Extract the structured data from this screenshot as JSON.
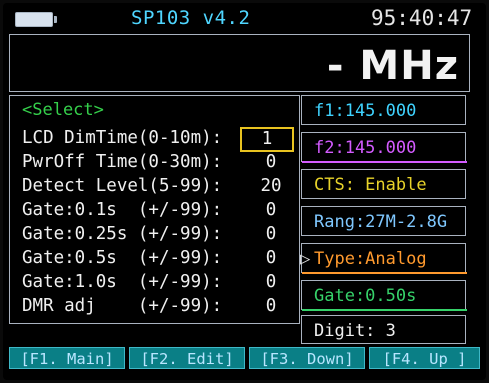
{
  "status_bar": {
    "model": "SP103 v4.2",
    "clock": "95:40:47"
  },
  "frequency_display": "- MHz",
  "menu": {
    "header": "<Select>",
    "items": [
      {
        "label": "LCD DimTime(0-10m):",
        "value": "1",
        "selected": true
      },
      {
        "label": "PwrOff Time(0-30m):",
        "value": "0"
      },
      {
        "label": "Detect Level(5-99):",
        "value": "20"
      },
      {
        "label": "Gate:0.1s  (+/-99):",
        "value": "0"
      },
      {
        "label": "Gate:0.25s (+/-99):",
        "value": "0"
      },
      {
        "label": "Gate:0.5s  (+/-99):",
        "value": "0"
      },
      {
        "label": "Gate:1.0s  (+/-99):",
        "value": "0"
      },
      {
        "label": "DMR adj    (+/-99):",
        "value": "0"
      }
    ]
  },
  "info": {
    "f1": "f1:145.000",
    "f2": "f2:145.000",
    "cts": "CTS: Enable",
    "range": "Rang:27M-2.8G",
    "type": "Type:Analog",
    "gate": "Gate:0.50s",
    "digit": "Digit: 3"
  },
  "colors": {
    "f1": "#3fd3ff",
    "f2": "#d35bff",
    "cts": "#e8d32a",
    "range": "#7fc8ff",
    "type": "#ff9a2e",
    "gate": "#36d26a",
    "digit": "#f0f0f0"
  },
  "function_keys": [
    {
      "label": "[F1. Main]"
    },
    {
      "label": "[F2. Edit]"
    },
    {
      "label": "[F3. Down]"
    },
    {
      "label": "[F4. Up ]"
    }
  ]
}
